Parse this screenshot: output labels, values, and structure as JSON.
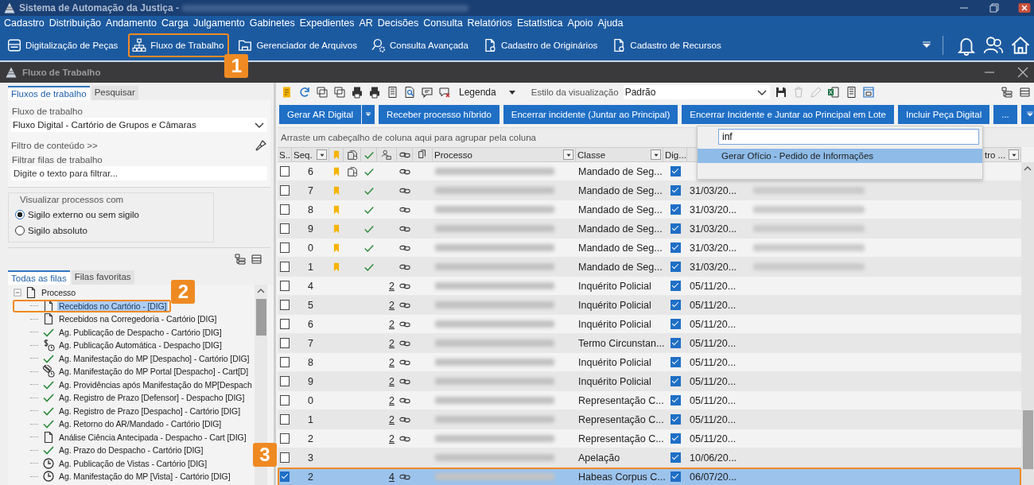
{
  "window": {
    "title": "Sistema de Automação da Justiça -"
  },
  "menu": [
    "Cadastro",
    "Distribuição",
    "Andamento",
    "Carga",
    "Julgamento",
    "Gabinetes",
    "Expedientes",
    "AR",
    "Decisões",
    "Consulta",
    "Relatórios",
    "Estatística",
    "Apoio",
    "Ajuda"
  ],
  "toolbar": [
    {
      "label": "Digitalização de Peças",
      "kind": "scanner"
    },
    {
      "label": "Fluxo de Trabalho",
      "kind": "hierarchy"
    },
    {
      "label": "Gerenciador de Arquivos",
      "kind": "folder"
    },
    {
      "label": "Consulta Avançada",
      "kind": "search"
    },
    {
      "label": "Cadastro de Originários",
      "kind": "document"
    },
    {
      "label": "Cadastro de Recursos",
      "kind": "document"
    }
  ],
  "subwindow": {
    "title": "Fluxo de Trabalho"
  },
  "left_panel": {
    "tabs": [
      {
        "label": "Fluxos de trabalho",
        "selected": true
      },
      {
        "label": "Pesquisar",
        "selected": false
      }
    ],
    "workflow_label": "Fluxo de trabalho",
    "workflow_value": "Fluxo Digital - Cartório de Grupos e Câmaras",
    "content_filter": "Filtro de conteúdo >>",
    "queue_filter_label": "Filtrar filas de trabalho",
    "queue_filter_placeholder": "Digite o texto para filtrar...",
    "visibility": {
      "title": "Visualizar processos com",
      "options": [
        {
          "label": "Sigilo externo ou sem sigilo",
          "selected": true
        },
        {
          "label": "Sigilo absoluto",
          "selected": false
        }
      ]
    },
    "queue_tabs": [
      {
        "label": "Todas as filas",
        "selected": true
      },
      {
        "label": "Filas favoritas",
        "selected": false
      }
    ],
    "tree": [
      {
        "label": "Processo",
        "kind": "document",
        "expanded": true,
        "selected": false,
        "children": [
          {
            "label": "Recebidos no Cartório - [DIG]",
            "kind": "document",
            "selected": true
          },
          {
            "label": "Recebidos na Corregedoria - Cartório [DIG]",
            "kind": "document",
            "selected": false
          },
          {
            "label": "Ag. Publicação de Despacho - Cartório [DIG]",
            "kind": "check",
            "selected": false
          },
          {
            "label": "Ag. Publicação Automática - Despacho [DIG]",
            "kind": "dollar-clock",
            "selected": false
          },
          {
            "label": "Ag. Manifestação do MP [Despacho] - Cartório [DIG]",
            "kind": "check",
            "selected": false
          },
          {
            "label": "Ag. Manifestação do MP Portal [Despacho] - Cart[D]",
            "kind": "capsule-clock",
            "selected": false
          },
          {
            "label": "Ag. Providências após Manifestação do MP[Despach",
            "kind": "check",
            "selected": false
          },
          {
            "label": "Ag. Registro de Prazo [Defensor] - Despacho [DIG]",
            "kind": "check",
            "selected": false
          },
          {
            "label": "Ag. Registro de Prazo [Despacho] - Cartório [DIG]",
            "kind": "check",
            "selected": false
          },
          {
            "label": "Ag. Retorno do AR/Mandado - Cartório [DIG]",
            "kind": "check",
            "selected": false
          },
          {
            "label": "Análise Ciência Antecipada - Despacho - Cart [DIG]",
            "kind": "document",
            "selected": false
          },
          {
            "label": "Ag. Prazo do Despacho - Cartório [DIG]",
            "kind": "check",
            "selected": false
          },
          {
            "label": "Ag. Publicação de Vistas - Cartório [DIG]",
            "kind": "clock",
            "selected": false
          },
          {
            "label": "Ag. Manifestação do MP [Vista] - Cartório [DIG]",
            "kind": "clock",
            "selected": false
          }
        ]
      }
    ]
  },
  "grid": {
    "legend": "Legenda",
    "view_style_label": "Estilo da visualização",
    "view_style": "Padrão",
    "actions": [
      {
        "label": "Gerar AR Digital",
        "kind": "split"
      },
      {
        "label": "Receber processo híbrido",
        "kind": "plain"
      },
      {
        "label": "Encerrar incidente (Juntar ao Principal)",
        "kind": "plain"
      },
      {
        "label": "Encerrar Incidente e Juntar ao Principal em Lote",
        "kind": "plain"
      },
      {
        "label": "Incluir Peça Digital",
        "kind": "plain"
      },
      {
        "label": "...",
        "kind": "plain"
      },
      {
        "kind": "menu"
      }
    ],
    "group_hint": "Arraste um cabeçalho de coluna aqui para agrupar pela coluna",
    "columns": [
      {
        "kind": "text",
        "label": "S...",
        "filter": false
      },
      {
        "kind": "text",
        "label": "Seq.",
        "filter": true
      },
      {
        "kind": "bookmark"
      },
      {
        "kind": "attachment"
      },
      {
        "kind": "check"
      },
      {
        "kind": "people"
      },
      {
        "kind": "link"
      },
      {
        "kind": "copy"
      },
      {
        "kind": "text",
        "label": "Processo",
        "filter": true
      },
      {
        "kind": "text",
        "label": "Classe",
        "filter": true
      },
      {
        "kind": "text",
        "label": "Dig...",
        "filter": false
      }
    ],
    "last_column": "tro ...",
    "rows": [
      {
        "checked": false,
        "seq": "6",
        "bookmarked": true,
        "attached": true,
        "approved": true,
        "count": "",
        "linked": true,
        "classe": "Mandado de Seg...",
        "digital": true,
        "date": "",
        "note_blurred": false,
        "selected": false
      },
      {
        "checked": false,
        "seq": "7",
        "bookmarked": true,
        "attached": false,
        "approved": true,
        "count": "",
        "linked": true,
        "classe": "Mandado de Seg...",
        "digital": true,
        "date": "31/03/20...",
        "note_blurred": true,
        "selected": false
      },
      {
        "checked": false,
        "seq": "8",
        "bookmarked": true,
        "attached": false,
        "approved": true,
        "count": "",
        "linked": true,
        "classe": "Mandado de Seg...",
        "digital": true,
        "date": "31/03/20...",
        "note_blurred": true,
        "selected": false
      },
      {
        "checked": false,
        "seq": "9",
        "bookmarked": true,
        "attached": false,
        "approved": true,
        "count": "",
        "linked": true,
        "classe": "Mandado de Seg...",
        "digital": true,
        "date": "31/03/20...",
        "note_blurred": true,
        "selected": false
      },
      {
        "checked": false,
        "seq": "0",
        "bookmarked": true,
        "attached": false,
        "approved": true,
        "count": "",
        "linked": true,
        "classe": "Mandado de Seg...",
        "digital": true,
        "date": "31/03/20...",
        "note_blurred": true,
        "selected": false
      },
      {
        "checked": false,
        "seq": "1",
        "bookmarked": true,
        "attached": false,
        "approved": true,
        "count": "",
        "linked": true,
        "classe": "Mandado de Seg...",
        "digital": true,
        "date": "31/03/20...",
        "note_blurred": true,
        "selected": false
      },
      {
        "checked": false,
        "seq": "4",
        "bookmarked": false,
        "attached": false,
        "approved": false,
        "count": "2",
        "linked": true,
        "classe": "Inquérito Policial",
        "digital": true,
        "date": "05/11/20...",
        "note_blurred": false,
        "selected": false
      },
      {
        "checked": false,
        "seq": "5",
        "bookmarked": false,
        "attached": false,
        "approved": false,
        "count": "2",
        "linked": true,
        "classe": "Inquérito Policial",
        "digital": true,
        "date": "05/11/20...",
        "note_blurred": false,
        "selected": false
      },
      {
        "checked": false,
        "seq": "6",
        "bookmarked": false,
        "attached": false,
        "approved": false,
        "count": "2",
        "linked": true,
        "classe": "Inquérito Policial",
        "digital": true,
        "date": "05/11/20...",
        "note_blurred": false,
        "selected": false
      },
      {
        "checked": false,
        "seq": "7",
        "bookmarked": false,
        "attached": false,
        "approved": false,
        "count": "2",
        "linked": true,
        "classe": "Termo Circunstan...",
        "digital": true,
        "date": "05/11/20...",
        "note_blurred": false,
        "selected": false
      },
      {
        "checked": false,
        "seq": "8",
        "bookmarked": false,
        "attached": false,
        "approved": false,
        "count": "2",
        "linked": true,
        "classe": "Inquérito Policial",
        "digital": true,
        "date": "05/11/20...",
        "note_blurred": false,
        "selected": false
      },
      {
        "checked": false,
        "seq": "9",
        "bookmarked": false,
        "attached": false,
        "approved": false,
        "count": "2",
        "linked": true,
        "classe": "Inquérito Policial",
        "digital": true,
        "date": "05/11/20...",
        "note_blurred": false,
        "selected": false
      },
      {
        "checked": false,
        "seq": "0",
        "bookmarked": false,
        "attached": false,
        "approved": false,
        "count": "2",
        "linked": true,
        "classe": "Representação C...",
        "digital": true,
        "date": "05/11/20...",
        "note_blurred": false,
        "selected": false
      },
      {
        "checked": false,
        "seq": "1",
        "bookmarked": false,
        "attached": false,
        "approved": false,
        "count": "2",
        "linked": true,
        "classe": "Representação C...",
        "digital": true,
        "date": "05/11/20...",
        "note_blurred": false,
        "selected": false
      },
      {
        "checked": false,
        "seq": "2",
        "bookmarked": false,
        "attached": false,
        "approved": false,
        "count": "2",
        "linked": true,
        "classe": "Representação C...",
        "digital": true,
        "date": "05/11/20...",
        "note_blurred": false,
        "selected": false
      },
      {
        "checked": false,
        "seq": "3",
        "bookmarked": false,
        "attached": false,
        "approved": false,
        "count": "",
        "linked": false,
        "classe": "Apelação",
        "digital": true,
        "date": "10/06/20...",
        "note_blurred": false,
        "selected": false
      },
      {
        "checked": true,
        "seq": "2",
        "bookmarked": false,
        "attached": false,
        "approved": false,
        "count": "4",
        "linked": true,
        "classe": "Habeas Corpus C...",
        "digital": true,
        "date": "06/07/20...",
        "note_blurred": false,
        "selected": true
      }
    ]
  },
  "action_search": {
    "value": "inf",
    "results": [
      {
        "label": "Gerar Ofício - Pedido de Informações",
        "selected": true
      }
    ]
  },
  "callouts": [
    "1",
    "2",
    "3"
  ]
}
